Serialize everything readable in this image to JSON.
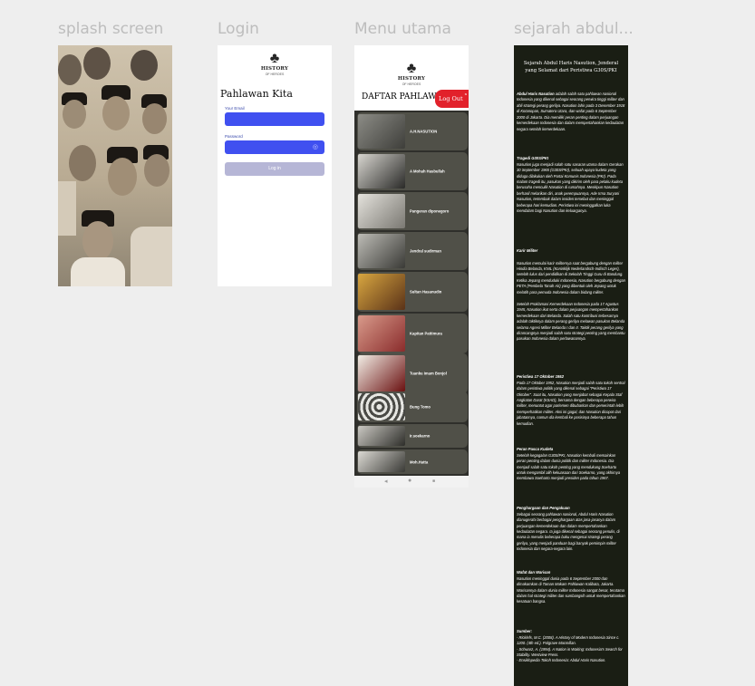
{
  "frames": {
    "splash": {
      "title": "splash screen"
    },
    "login": {
      "title": "Login"
    },
    "menu": {
      "title": "Menu utama"
    },
    "sejarah": {
      "title": "sejarah abdul..."
    }
  },
  "logo": {
    "text": "HISTORY",
    "subtext": "OF HEROES",
    "icon": "tree-book-icon"
  },
  "login": {
    "heading": "Pahlawan Kita",
    "email_label": "Your Email",
    "password_label": "Password",
    "button_label": "Log in",
    "eye_icon": "eye-off-icon"
  },
  "menu": {
    "heading": "DAFTAR PAHLAWAN",
    "logout_label": "Log Out",
    "close_label": "x",
    "heroes": [
      {
        "name": "A.H.NASUTION"
      },
      {
        "name": "A Mohah Hasbullah"
      },
      {
        "name": "Pangeran diponegoro"
      },
      {
        "name": "Jendral sudirman"
      },
      {
        "name": "Sultan Hasanudin"
      },
      {
        "name": "Kapitan Pattimura"
      },
      {
        "name": "Tuanku Imam Bonjol"
      },
      {
        "name": "Bung Tomo"
      },
      {
        "name": "Ir.soekarno"
      },
      {
        "name": "Moh.Hatta"
      }
    ],
    "nav": {
      "back": "◂",
      "home": "●",
      "recent": "■"
    }
  },
  "sejarah": {
    "title": "Sejarah Abdul Haris Nasution, Jenderal yang Selamat dari Peristiwa G30S/PKI",
    "intro_name": "Abdul Haris Nasution",
    "intro_text": " adalah salah satu pahlawan nasional Indonesia yang dikenal sebagai seorang perwira tinggi militer dan ahli strategi perang gerilya. Nasution lahir pada 3 Desember 1918 di Kotanopan, Sumatera Utara, dan wafat pada 6 September 2000 di Jakarta. Dia memiliki peran penting dalam perjuangan kemerdekaan Indonesia dan dalam mempertahankan kedaulatan negara setelah kemerdekaan.",
    "sections": [
      {
        "heading": "Tragedi G30S/PKI",
        "text": "Nasution juga menjadi salah satu sasaran utama dalam Gerakan 30 September 1965 (G30S/PKI), sebuah upaya kudeta yang diduga dilakukan oleh Partai Komunis Indonesia (PKI). Pada malam tragedi itu, pasukan yang dikirim oleh para pelaku kudeta berusaha menculik Nasution di rumahnya. Meskipun Nasution berhasil melarikan diri, anak perempuannya, Ade Irma Suryani Nasution, tertembak dalam insiden tersebut dan meninggal beberapa hari kemudian. Peristiwa ini meninggalkan luka mendalam bagi Nasution dan keluarganya."
      },
      {
        "heading": "Karir Militer",
        "text": "Nasution memulai karir militernya saat bergabung dengan militer Hindia Belanda, KNIL (Koninklijk Nederlandsch-Indisch Leger), setelah lulus dari pendidikan di Sekolah Tinggi Guru di Bandung. Ketika Jepang menduduki Indonesia, Nasution bergabung dengan PETA (Pembela Tanah Air) yang dibentuk oleh Jepang untuk melatih para pemuda Indonesia dalam bidang militer.\n\nSetelah Proklamasi Kemerdekaan Indonesia pada 17 Agustus 1945, Nasution ikut serta dalam perjuangan mempertahankan kemerdekaan dari Belanda. Salah satu kontribusi terbesarnya adalah taktiknya dalam perang gerilya melawan pasukan Belanda selama Agresi Militer Belanda I dan II. Taktik perang gerilya yang dirancangnya menjadi salah satu strategi penting yang membantu pasukan Indonesia dalam perlawanannya."
      },
      {
        "heading": "Peristiwa 17 Oktober 1952",
        "text": "Pada 17 Oktober 1952, Nasution menjadi salah satu tokoh sentral dalam peristiwa politik yang dikenal sebagai \"Peristiwa 17 Oktober\". Saat itu, Nasution yang menjabat sebagai Kepala Staf Angkatan Darat (KSAD), bersama dengan beberapa perwira militer, menuntut agar parlemen dibubarkan dan pemerintah lebih memperhatikan militer. Aksi ini gagal, dan Nasution dicopot dari jabatannya, namun dia kembali ke posisinya beberapa tahun kemudian."
      },
      {
        "heading": "Peran Pasca Kudeta",
        "text": "Setelah kegagalan G30S/PKI, Nasution kembali memainkan peran penting dalam dunia politik dan militer Indonesia. Dia menjadi salah satu tokoh penting yang mendukung Soeharto untuk mengambil alih kekuasaan dari Soekarno, yang akhirnya membawa Soeharto menjadi presiden pada tahun 1967."
      },
      {
        "heading": "Penghargaan dan Pengakuan",
        "text": "Sebagai seorang pahlawan nasional, Abdul Haris Nasution dianugerahi berbagai penghargaan atas jasa-jasanya dalam perjuangan kemerdekaan dan dalam mempertahankan kedaulatan negara. Ia juga dikenal sebagai seorang penulis, di mana ia menulis beberapa buku mengenai strategi perang gerilya, yang menjadi panduan bagi banyak pemimpin militer Indonesia dan negara-negara lain."
      },
      {
        "heading": "Wafat dan Warisan",
        "text": "Nasution meninggal dunia pada 6 September 2000 dan dimakamkan di Taman Makam Pahlawan Kalibata, Jakarta. Warisannya dalam dunia militer Indonesia sangat besar, terutama dalam hal strategi militer dan sumbangsih untuk mempertahankan kesatuan bangsa."
      }
    ],
    "sources_heading": "Sumber:",
    "sources": [
      "- Ricklefs, M.C. (2008). A History of Modern Indonesia Since c. 1200. (4th ed.). Palgrave Macmillan.",
      "- Schwarz, A. (1994). A Nation in Waiting: Indonesia's Search for Stability. Westview Press.",
      "- Ensiklopedia Tokoh Indonesia: Abdul Haris Nasution."
    ]
  },
  "colors": {
    "canvas": "#eeeeee",
    "input_blue": "#4050f0",
    "login_button": "#b6b6d6",
    "logout_red": "#e2212b",
    "menu_bg": "#2f2f2b",
    "card_bg": "#505048",
    "article_bg": "#1a1e14"
  }
}
